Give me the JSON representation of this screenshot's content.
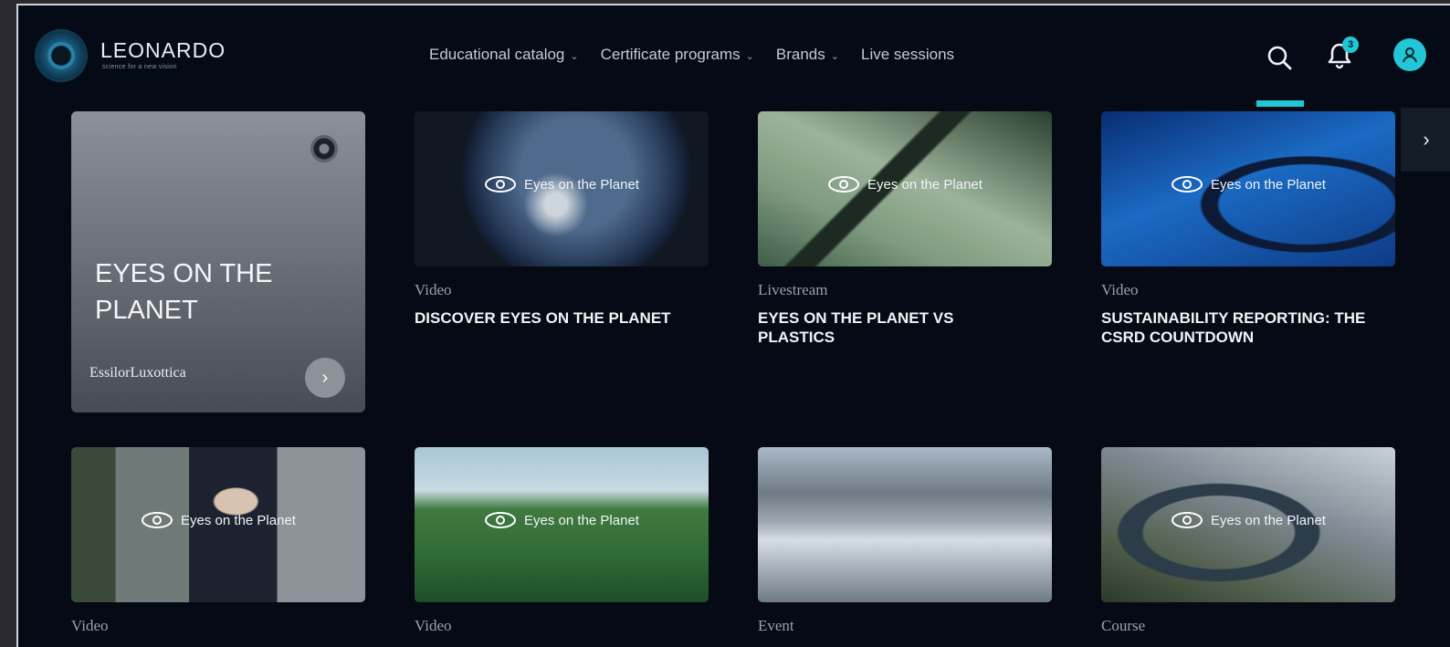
{
  "brand": {
    "name": "LEONARDO",
    "tagline": "science for a new vision"
  },
  "nav": {
    "items": [
      {
        "label": "Educational catalog",
        "dropdown": true
      },
      {
        "label": "Certificate programs",
        "dropdown": true
      },
      {
        "label": "Brands",
        "dropdown": true
      },
      {
        "label": "Live sessions",
        "dropdown": false
      }
    ]
  },
  "header_actions": {
    "notifications_count": "3",
    "accent_color": "#22c6d6"
  },
  "featured": {
    "title": "EYES ON THE PLANET",
    "brand": "EssilorLuxottica"
  },
  "overlay_label": "Eyes on the Planet",
  "cards": [
    {
      "type": "Video",
      "title": "DISCOVER EYES ON THE PLANET",
      "thumb": "earth"
    },
    {
      "type": "Livestream",
      "title": "EYES ON THE PLANET VS PLASTICS",
      "thumb": "glasses-green"
    },
    {
      "type": "Video",
      "title": "SUSTAINABILITY REPORTING: THE CSRD COUNTDOWN",
      "thumb": "glasses-blue"
    },
    {
      "type": "Video",
      "title": "",
      "thumb": "person"
    },
    {
      "type": "Video",
      "title": "",
      "thumb": "forest"
    },
    {
      "type": "Event",
      "title": "",
      "thumb": "factory"
    },
    {
      "type": "Course",
      "title": "",
      "thumb": "sculpture"
    }
  ]
}
